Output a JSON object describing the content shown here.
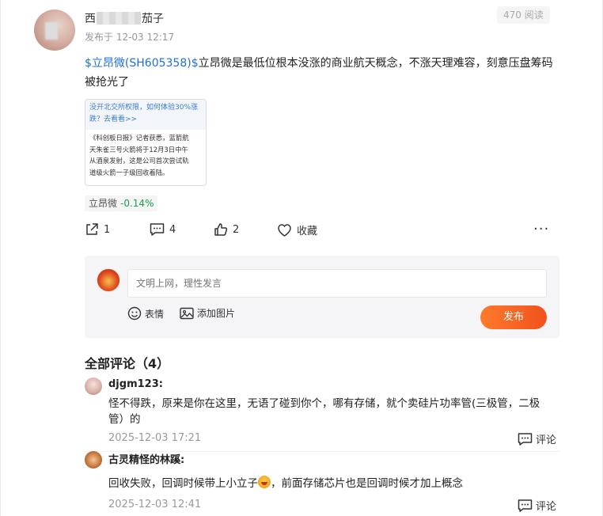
{
  "post": {
    "author_prefix": "西",
    "author_suffix": "茄子",
    "posted": "发布于 12-03 12:17",
    "reads": "470 阅读",
    "stock_link": "$立昂微(SH605358)$",
    "text_rest": "立昂微是最低位根本没涨的商业航天概念，不涨天理难容，刻意压盘筹码被抢光了"
  },
  "card": {
    "top_line1": "没开北交所权限，如何体验30%涨",
    "top_line2": "跌？去看看>>",
    "body_line1": "《科创板日报》记者获悉，蓝箭航",
    "body_line2": "天朱雀三号火箭将于12月3日中午",
    "body_line3": "从酒泉发射，这是公司首次尝试轨",
    "body_line4": "道级火箭一子级回收着陆。"
  },
  "stock_tag": {
    "name": "立昂微",
    "change": "-0.14%",
    "change_color": "#15a14a"
  },
  "actions": {
    "share_count": "1",
    "comment_count": "4",
    "like_count": "2",
    "favorite_label": "收藏",
    "more": "···"
  },
  "composer": {
    "placeholder": "文明上网，理性发言",
    "emoji_label": "表情",
    "image_label": "添加图片",
    "publish_label": "发布",
    "publish_color": "#f0521c"
  },
  "comments_title": "全部评论（4）",
  "comments": [
    {
      "name": "djgm123:",
      "text_line1": "怪不得跌，原来是你在这里，无语了碰到你个，哪有存储，就个卖硅片功率管(三极管，二极",
      "text_line2": "管）的",
      "time": "2025-12-03 17:21",
      "reply_label": "评论"
    },
    {
      "name": "古灵精怪的林蹊:",
      "text_before": "回收失败，回调时候带上小立子",
      "text_after": "，前面存储芯片也是回调时候才加上概念",
      "time": "2025-12-03 12:41",
      "reply_label": "评论"
    }
  ]
}
